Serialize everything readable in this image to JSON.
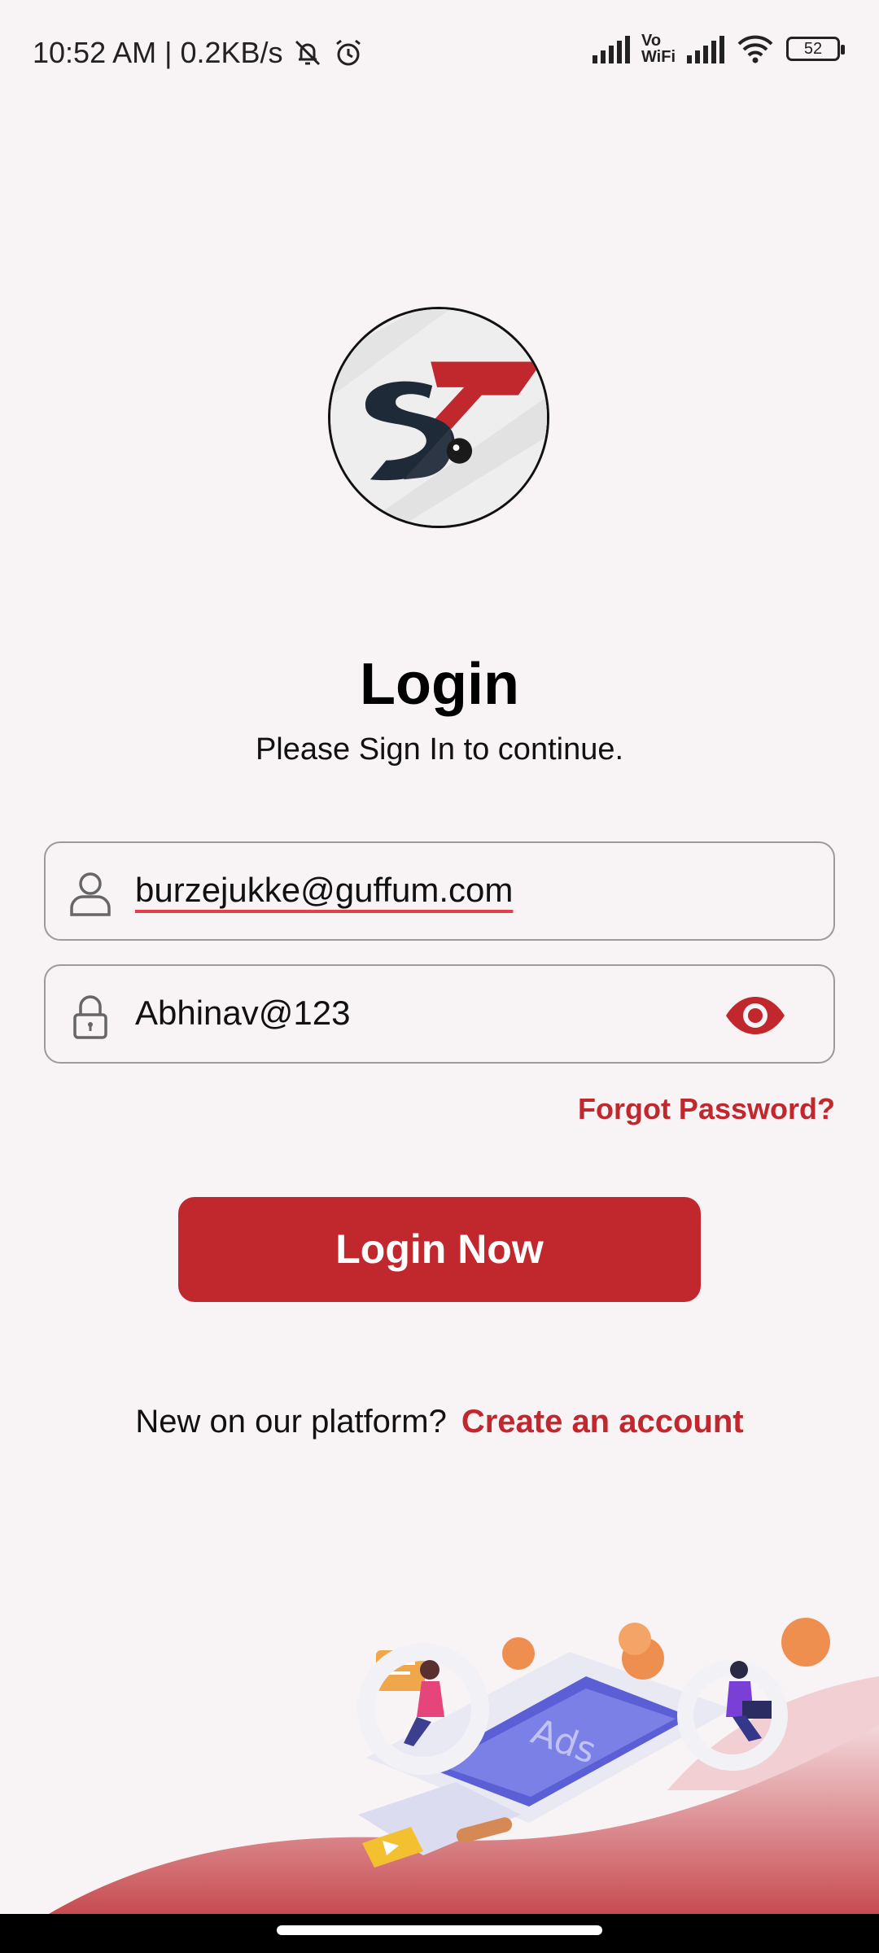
{
  "status_bar": {
    "time_speed": "10:52 AM | 0.2KB/s",
    "vowifi_top": "Vo",
    "vowifi_bottom": "WiFi",
    "battery": "52",
    "icons": [
      "mute-bell-icon",
      "alarm-icon",
      "signal-icon",
      "wifi-icon",
      "battery-icon"
    ]
  },
  "header": {
    "title": "Login",
    "subtitle": "Please Sign In to continue."
  },
  "form": {
    "email_value": "burzejukke@guffum.com",
    "password_value": "Abhinav@123",
    "forgot_label": "Forgot Password?",
    "submit_label": "Login Now"
  },
  "footer": {
    "question": "New on our platform?",
    "create_label": "Create an account"
  },
  "illustration": {
    "ads_label": "Ads"
  },
  "colors": {
    "accent": "#c0282d",
    "background": "#f8f3f5"
  }
}
